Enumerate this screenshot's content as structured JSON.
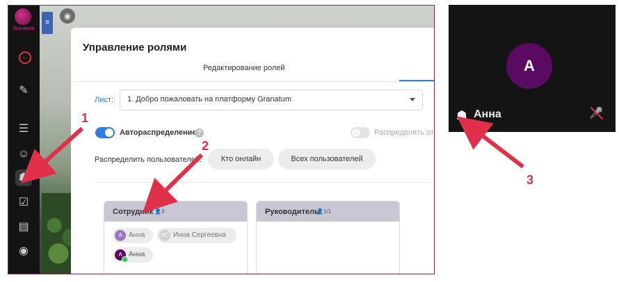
{
  "app": {
    "logo_text": "Granatum"
  },
  "modal": {
    "title": "Управление ролями",
    "tab": "Редактирование ролей",
    "sheet_label": "Лист:",
    "sheet_value": "1. Добро пожаловать на платформу Granatum",
    "auto_label": "Автораспределение",
    "distribute_label": "Распределять от",
    "assign_label": "Распределить пользователей:",
    "btn_online": "Кто онлайн",
    "btn_all": "Всех пользователей"
  },
  "roles": [
    {
      "title": "Сотрудник",
      "count": "3",
      "chips": [
        {
          "initials": "A",
          "name": "Анна",
          "color": "#9b78c2"
        },
        {
          "initials": "ИС",
          "name": "Инна Сергеевна",
          "color": "#cfcfcf"
        },
        {
          "initials": "A",
          "name": "Анна",
          "color": "#5a0a60",
          "online": true
        }
      ]
    },
    {
      "title": "Руководитель",
      "count": "1/1",
      "chips": []
    }
  ],
  "video": {
    "initial": "A",
    "name": "Анна"
  },
  "callouts": [
    "1",
    "2",
    "3"
  ],
  "icons": {
    "rail": [
      "exit-icon",
      "tools-icon",
      "slides-icon",
      "users-icon",
      "mask-icon",
      "tasks-icon",
      "notes-icon",
      "record-icon"
    ],
    "video": [
      "mask-icon",
      "mic-off-icon"
    ]
  },
  "colors": {
    "accent": "#2f7de1",
    "callout": "#e0304a",
    "brand": "#d0308a"
  }
}
